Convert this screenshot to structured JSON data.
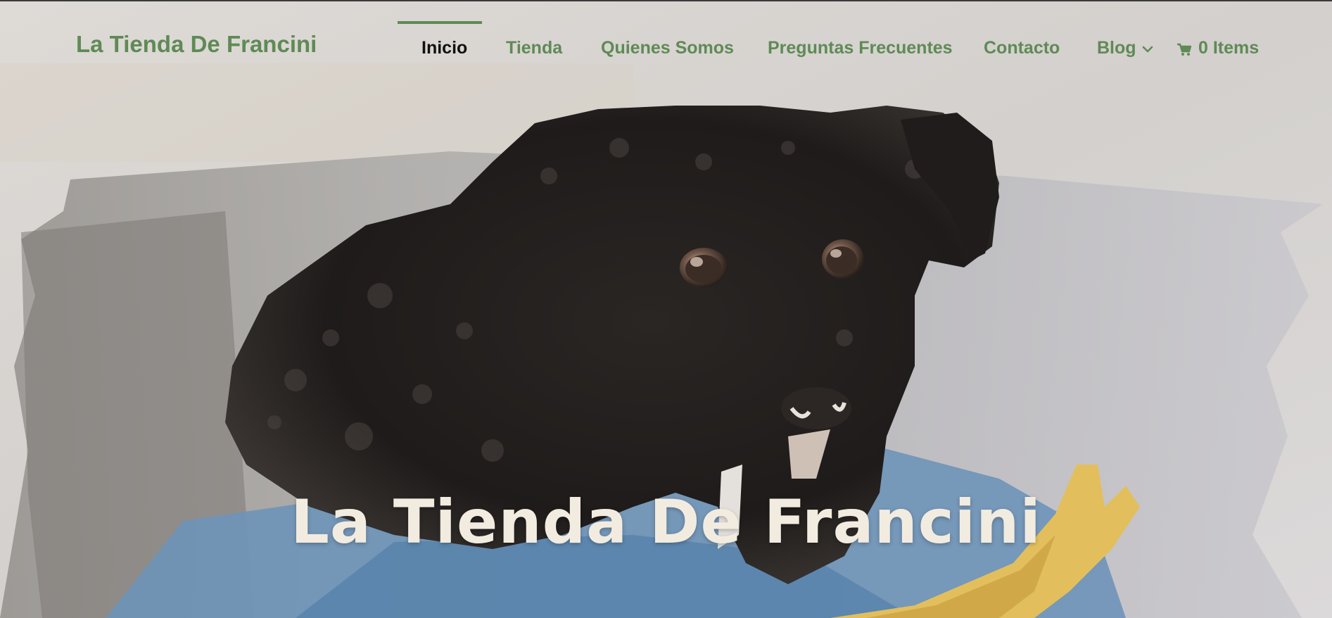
{
  "site": {
    "title": "La Tienda De Francini"
  },
  "nav": {
    "items": [
      {
        "label": "Inicio",
        "active": true
      },
      {
        "label": "Tienda",
        "active": false
      },
      {
        "label": "Quienes Somos",
        "active": false
      },
      {
        "label": "Preguntas Frecuentes",
        "active": false
      },
      {
        "label": "Contacto",
        "active": false
      },
      {
        "label": "Blog",
        "active": false,
        "has_dropdown": true
      }
    ],
    "cart_label": "0 Items"
  },
  "hero": {
    "title": "La Tienda De Francini"
  },
  "icons": {
    "dropdown": "chevron-down-icon",
    "cart": "cart-icon"
  },
  "colors": {
    "brand_green": "#5f8a55",
    "active_text": "#111111",
    "hero_title": "#f2ece0"
  }
}
